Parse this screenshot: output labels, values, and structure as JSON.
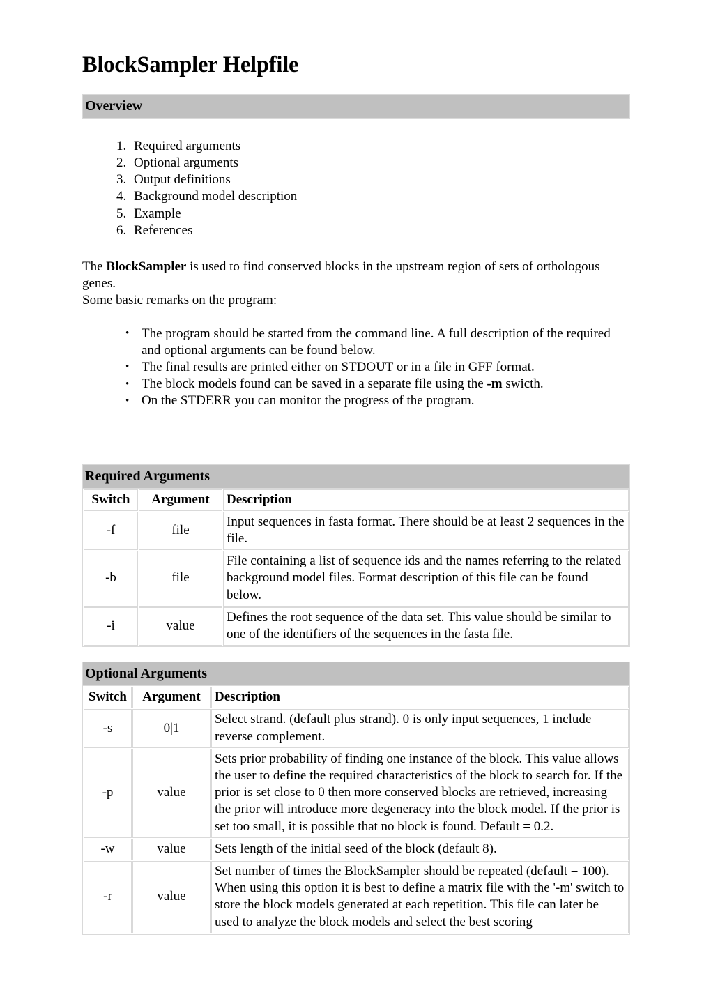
{
  "document": {
    "title": "BlockSampler Helpfile"
  },
  "sections": {
    "overview": {
      "heading": "Overview",
      "toc": [
        "Required arguments",
        "Optional arguments",
        "Output definitions",
        "Background model description",
        "Example",
        "References"
      ],
      "intro": {
        "line1_before": "The ",
        "line1_bold": "BlockSampler",
        "line1_after": " is used to find conserved blocks in the upstream region of sets of orthologous genes.",
        "line2": "Some basic remarks on the program:"
      },
      "remarks": [
        {
          "before": "The program should be started from the command line. A full description of the required and optional arguments can be found below.",
          "bold": "",
          "after": ""
        },
        {
          "before": "The final results are printed either on STDOUT or in a file in GFF format.",
          "bold": "",
          "after": ""
        },
        {
          "before": "The block models found can be saved in a separate file using the ",
          "bold": "-m",
          "after": " swicth."
        },
        {
          "before": "On the STDERR you can monitor the progress of the program.",
          "bold": "",
          "after": ""
        }
      ]
    },
    "required_arguments": {
      "heading": "Required Arguments",
      "columns": [
        "Switch",
        "Argument",
        "Description"
      ],
      "rows": [
        {
          "switch": "-f",
          "argument": "file",
          "description": "Input sequences in fasta format. There should be at least 2 sequences in the file."
        },
        {
          "switch": "-b",
          "argument": "file",
          "description": "File containing a list of sequence ids and the names referring to the related background model files. Format description of this file can be found below."
        },
        {
          "switch": "-i",
          "argument": "value",
          "description": "Defines the root sequence of the data set. This value should be similar to one of the identifiers of the sequences in the fasta file."
        }
      ]
    },
    "optional_arguments": {
      "heading": "Optional Arguments",
      "columns": [
        "Switch",
        "Argument",
        "Description"
      ],
      "rows": [
        {
          "switch": "-s",
          "argument": "0|1",
          "description": "Select strand. (default plus strand). 0 is only input sequences, 1 include reverse complement."
        },
        {
          "switch": "-p",
          "argument": "value",
          "description": "Sets prior probability of finding one instance of the block. This value allows the user to define the required characteristics of the block to search for. If the prior is set close to 0 then more conserved blocks are retrieved, increasing the prior will introduce more degeneracy into the block model. If the prior is set too small, it is possible that no block is found. Default = 0.2."
        },
        {
          "switch": "-w",
          "argument": "value",
          "description": "Sets length of the initial seed of the block (default 8)."
        },
        {
          "switch": "-r",
          "argument": "value",
          "description": "Set number of times the BlockSampler should be repeated (default = 100). When using this option it is best to define a matrix file with the '-m' switch to store the block models generated at each repetition. This file can later be used to analyze the block models and select the best scoring"
        }
      ]
    }
  },
  "colors": {
    "section_bar_background": "#c0c0c0",
    "table_border": "#d9d9d9",
    "page_background": "#ffffff",
    "text": "#000000"
  }
}
